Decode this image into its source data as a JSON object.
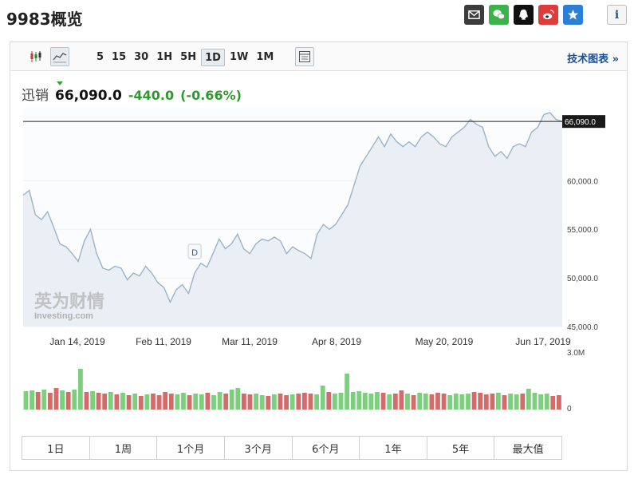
{
  "page": {
    "title": "9983概览"
  },
  "share": {
    "buttons": [
      "email-icon",
      "wechat-icon",
      "qq-icon",
      "weibo-icon",
      "favorite-star-icon"
    ],
    "info_label": "i",
    "colors": {
      "email": "#3c3c3c",
      "wechat": "#3bb24a",
      "qq": "#111111",
      "weibo": "#e03b3b",
      "star": "#2c7fd6"
    }
  },
  "toolbar": {
    "periods": [
      "5",
      "15",
      "30",
      "1H",
      "5H",
      "1D",
      "1W",
      "1M"
    ],
    "active_period": "1D",
    "tech_link": "技术图表 »"
  },
  "quote": {
    "name": "迅销",
    "price": "66,090.0",
    "change": "-440.0",
    "change_pct": "(-0.66%)",
    "color_change": "#2e9a2e"
  },
  "chart_data": [
    {
      "type": "area",
      "title": "",
      "xlabel": "",
      "ylabel": "",
      "x_tick_labels": [
        "Jan 14, 2019",
        "Feb 11, 2019",
        "Mar 11, 2019",
        "Apr 8, 2019",
        "May 20, 2019",
        "Jun 17, 2019"
      ],
      "y_tick_labels": [
        "45,000.0",
        "50,000.0",
        "55,000.0",
        "60,000.0"
      ],
      "ylim": [
        45000,
        67500
      ],
      "current_value_label": "66,090.0",
      "current_value": 66090,
      "event_marker": "D",
      "watermark": {
        "brand": "英为财情",
        "sub": "Investing.com"
      },
      "values": [
        58500,
        59000,
        56500,
        56000,
        56800,
        55200,
        53500,
        53200,
        52500,
        51700,
        53800,
        55000,
        52500,
        51000,
        50800,
        51200,
        51000,
        49800,
        50500,
        50200,
        51200,
        50500,
        49500,
        49000,
        47500,
        48800,
        49300,
        48400,
        50500,
        51500,
        51100,
        52500,
        54000,
        53000,
        53500,
        54500,
        53000,
        52500,
        53500,
        54000,
        53800,
        54200,
        53800,
        52500,
        53200,
        52800,
        52500,
        52000,
        54500,
        55500,
        55000,
        55500,
        56500,
        57500,
        59500,
        61500,
        62500,
        63500,
        64500,
        63500,
        64800,
        64000,
        63500,
        64000,
        63500,
        64500,
        65000,
        64500,
        63800,
        63500,
        64500,
        65000,
        65500,
        66300,
        65800,
        65500,
        63500,
        62500,
        63000,
        62300,
        63500,
        63800,
        63500,
        65000,
        65500,
        66800,
        67000,
        66300,
        66090
      ],
      "line_color": "#9fb2c4",
      "fill_color": "#e9eff5"
    },
    {
      "type": "bar",
      "title": "",
      "y_tick_labels": [
        "3.0M",
        "0"
      ],
      "ylim": [
        0,
        3000000
      ],
      "volume_values": [
        1.15,
        1.2,
        1.1,
        1.25,
        1.05,
        1.35,
        1.2,
        1.1,
        1.25,
        2.55,
        1.1,
        1.15,
        1.05,
        1.0,
        1.1,
        0.95,
        1.05,
        0.9,
        1.0,
        0.85,
        0.95,
        1.0,
        0.9,
        1.1,
        1.0,
        0.95,
        1.05,
        0.9,
        1.0,
        0.95,
        1.05,
        0.9,
        1.1,
        1.0,
        1.25,
        1.35,
        1.0,
        0.95,
        1.0,
        0.9,
        0.85,
        0.95,
        1.0,
        0.9,
        0.95,
        1.0,
        1.05,
        1.0,
        0.95,
        1.5,
        1.1,
        1.0,
        1.05,
        2.25,
        1.1,
        1.15,
        1.05,
        1.0,
        1.1,
        1.05,
        0.95,
        1.0,
        1.2,
        1.0,
        0.9,
        1.05,
        1.0,
        0.95,
        1.05,
        1.0,
        0.9,
        1.0,
        0.95,
        1.0,
        1.1,
        1.05,
        0.95,
        1.0,
        1.05,
        0.9,
        1.0,
        0.95,
        1.0,
        1.3,
        1.05,
        0.95,
        1.0,
        0.85,
        0.9
      ],
      "volume_units": "M",
      "volume_directions": [
        "u",
        "u",
        "d",
        "u",
        "d",
        "d",
        "u",
        "d",
        "u",
        "u",
        "d",
        "u",
        "d",
        "d",
        "u",
        "d",
        "u",
        "d",
        "u",
        "d",
        "u",
        "d",
        "d",
        "d",
        "d",
        "u",
        "u",
        "d",
        "u",
        "u",
        "d",
        "u",
        "u",
        "d",
        "u",
        "u",
        "d",
        "d",
        "u",
        "u",
        "d",
        "u",
        "d",
        "d",
        "u",
        "d",
        "d",
        "d",
        "u",
        "u",
        "d",
        "u",
        "u",
        "u",
        "u",
        "u",
        "u",
        "u",
        "u",
        "d",
        "u",
        "d",
        "d",
        "u",
        "d",
        "u",
        "u",
        "d",
        "d",
        "d",
        "u",
        "u",
        "u",
        "u",
        "d",
        "d",
        "d",
        "d",
        "u",
        "d",
        "u",
        "u",
        "d",
        "u",
        "u",
        "u",
        "u",
        "d",
        "d"
      ],
      "up_color": "#7ccf7c",
      "down_color": "#d36b6b"
    }
  ],
  "ranges": [
    "1日",
    "1周",
    "1个月",
    "3个月",
    "6个月",
    "1年",
    "5年",
    "最大值"
  ]
}
